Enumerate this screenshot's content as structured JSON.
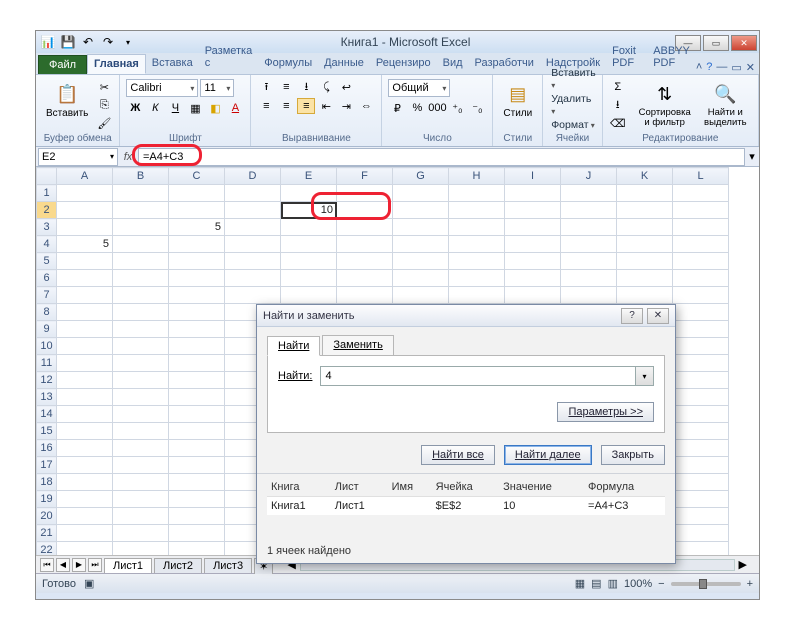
{
  "window": {
    "title": "Книга1 - Microsoft Excel"
  },
  "ribbon": {
    "file_tab": "Файл",
    "tabs": [
      "Главная",
      "Вставка",
      "Разметка с",
      "Формулы",
      "Данные",
      "Рецензиро",
      "Вид",
      "Разработчи",
      "Надстройк",
      "Foxit PDF",
      "ABBYY PDF"
    ],
    "active_tab_index": 0
  },
  "home": {
    "clipboard": {
      "paste": "Вставить",
      "label": "Буфер обмена"
    },
    "font": {
      "name": "Calibri",
      "size": "11",
      "label": "Шрифт"
    },
    "alignment": {
      "label": "Выравнивание"
    },
    "number": {
      "format": "Общий",
      "label": "Число"
    },
    "styles": {
      "styles_btn": "Стили",
      "label": "Стили"
    },
    "cells": {
      "insert": "Вставить",
      "delete": "Удалить",
      "format": "Формат",
      "label": "Ячейки"
    },
    "editing": {
      "sort": "Сортировка и фильтр",
      "find": "Найти и выделить",
      "label": "Редактирование"
    }
  },
  "namebox": "E2",
  "formula": "=A4+C3",
  "columns": [
    "A",
    "B",
    "C",
    "D",
    "E",
    "F",
    "G",
    "H",
    "I",
    "J",
    "K",
    "L"
  ],
  "rows": 22,
  "cells": {
    "C3": "5",
    "A4": "5",
    "E2": "10"
  },
  "active_cell": "E2",
  "sheets": [
    "Лист1",
    "Лист2",
    "Лист3"
  ],
  "statusbar": {
    "ready": "Готово",
    "zoom": "100%"
  },
  "dialog": {
    "title": "Найти и заменить",
    "tab_find": "Найти",
    "tab_replace": "Заменить",
    "find_label": "Найти:",
    "find_value": "4",
    "params_btn": "Параметры >>",
    "find_all": "Найти все",
    "find_next": "Найти далее",
    "close": "Закрыть",
    "result_headers": {
      "book": "Книга",
      "sheet": "Лист",
      "name": "Имя",
      "cell": "Ячейка",
      "value": "Значение",
      "formula": "Формула"
    },
    "results": [
      {
        "book": "Книга1",
        "sheet": "Лист1",
        "name": "",
        "cell": "$E$2",
        "value": "10",
        "formula": "=A4+C3"
      }
    ],
    "status": "1 ячеек найдено"
  }
}
